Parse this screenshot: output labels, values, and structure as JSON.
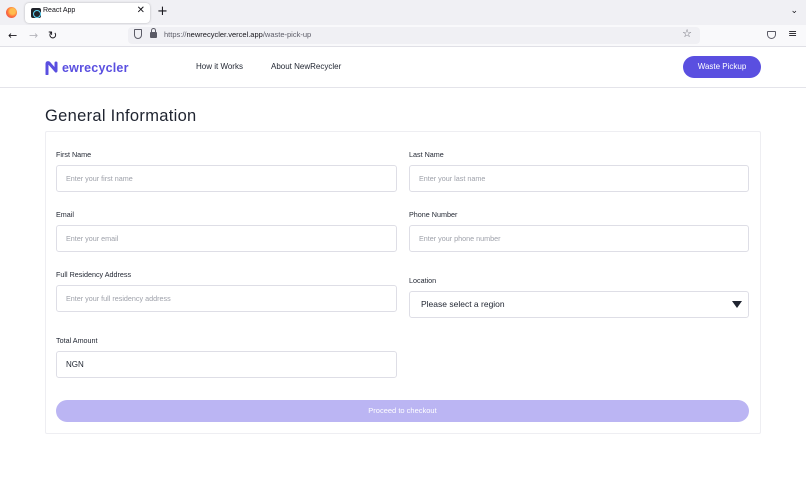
{
  "browser": {
    "tab_title": "React App",
    "tab_close": "✕",
    "new_tab": "+",
    "tab_list": "⌄",
    "url_prefix": "https://",
    "url_host": "newrecycler.vercel.app",
    "url_path": "/waste-pick-up",
    "back": "←",
    "forward": "→",
    "reload": "↻",
    "star": "☆",
    "menu": "≡"
  },
  "header": {
    "logo_text": "ewrecycler",
    "logo_color": "#5a4fe0",
    "nav": [
      "How it Works",
      "About NewRecycler"
    ],
    "cta": "Waste Pickup"
  },
  "form": {
    "title": "General Information",
    "first_name": {
      "label": "First Name",
      "placeholder": "Enter your first name"
    },
    "last_name": {
      "label": "Last Name",
      "placeholder": "Enter your last name"
    },
    "email": {
      "label": "Email",
      "placeholder": "Enter your email"
    },
    "phone": {
      "label": "Phone Number",
      "placeholder": "Enter your phone number"
    },
    "address": {
      "label": "Full Residency Address",
      "placeholder": "Enter your full residency address"
    },
    "location": {
      "label": "Location",
      "selected": "Please select a region"
    },
    "total": {
      "label": "Total Amount",
      "value": "NGN"
    },
    "submit": "Proceed to checkout",
    "submit_color": "#bbb5f3"
  }
}
